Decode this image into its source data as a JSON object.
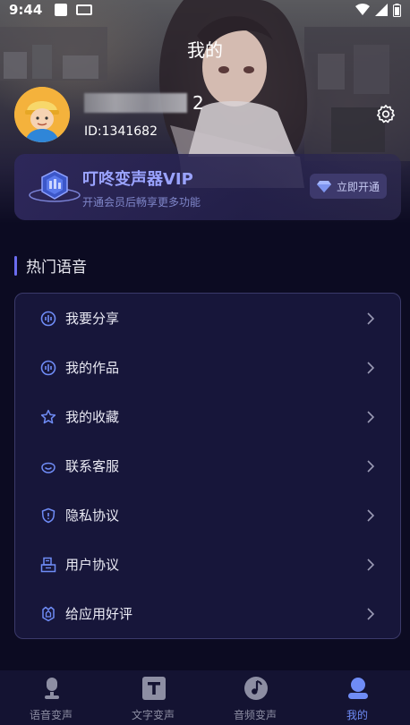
{
  "status_bar": {
    "time": "9:44"
  },
  "header": {
    "title": "我的"
  },
  "user": {
    "name_suffix": "2",
    "id_text": "ID:1341682"
  },
  "vip": {
    "title": "叮咚变声器VIP",
    "subtitle": "开通会员后畅享更多功能",
    "button_label": "立即开通"
  },
  "section": {
    "title": "热门语音"
  },
  "menu": {
    "items": [
      {
        "label": "我要分享",
        "icon": "share-wave-icon"
      },
      {
        "label": "我的作品",
        "icon": "works-wave-icon"
      },
      {
        "label": "我的收藏",
        "icon": "star-icon"
      },
      {
        "label": "联系客服",
        "icon": "headset-icon"
      },
      {
        "label": "隐私协议",
        "icon": "shield-icon"
      },
      {
        "label": "用户协议",
        "icon": "document-icon"
      },
      {
        "label": "给应用好评",
        "icon": "thumb-up-icon"
      }
    ]
  },
  "tabs": [
    {
      "label": "语音变声",
      "icon": "microphone-icon"
    },
    {
      "label": "文字变声",
      "icon": "text-t-icon"
    },
    {
      "label": "音频变声",
      "icon": "music-disc-icon"
    },
    {
      "label": "我的",
      "icon": "user-icon",
      "active": true
    }
  ],
  "colors": {
    "accent": "#6f8cf6",
    "vip_text": "#9aa3ff",
    "background": "#0c0b22"
  }
}
